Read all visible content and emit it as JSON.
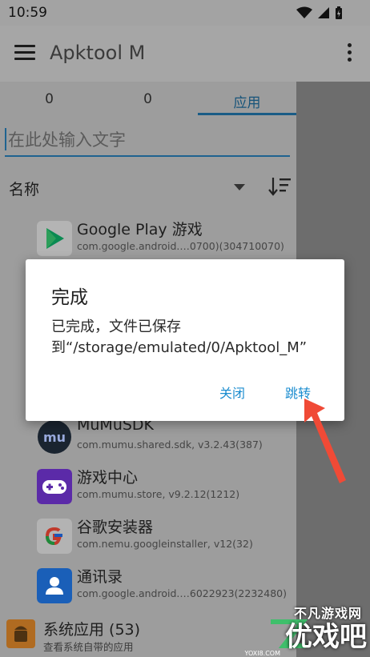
{
  "status": {
    "time": "10:59"
  },
  "app_bar": {
    "title": "Apktool M"
  },
  "tabs": [
    {
      "label": "0"
    },
    {
      "label": "0"
    },
    {
      "label": "应用"
    }
  ],
  "search": {
    "placeholder": "在此处输入文字"
  },
  "sort": {
    "label": "名称"
  },
  "apps": [
    {
      "name": "Google Play 游戏",
      "package": "com.google.android.…0700)(304710070)",
      "icon": "google-play-games-icon",
      "color": "#0a8a52"
    },
    {
      "name": "MuMuSDK",
      "package": "com.mumu.shared.sdk, v3.2.43(387)",
      "icon": "mumu-icon",
      "color": "#1a2430"
    },
    {
      "name": "游戏中心",
      "package": "com.mumu.store, v9.2.12(1212)",
      "icon": "gamepad-icon",
      "color": "#5b2aa8"
    },
    {
      "name": "谷歌安装器",
      "package": "com.nemu.googleinstaller, v12(32)",
      "icon": "google-g-icon",
      "color": "#ffffff"
    },
    {
      "name": "通讯录",
      "package": "com.google.android.…6022923(2232480)",
      "icon": "contacts-icon",
      "color": "#1a5fb8"
    }
  ],
  "system_apps": {
    "name": "系统应用 (53)",
    "sub": "查看系统自带的应用"
  },
  "dialog": {
    "title": "完成",
    "message": "已完成，文件已保存到“/storage/emulated/0/Apktool_M”",
    "close_label": "关闭",
    "jump_label": "跳转"
  },
  "watermark": {
    "site": "不凡游戏网",
    "brand": "优戏吧",
    "url": "YOXI8.COM"
  }
}
